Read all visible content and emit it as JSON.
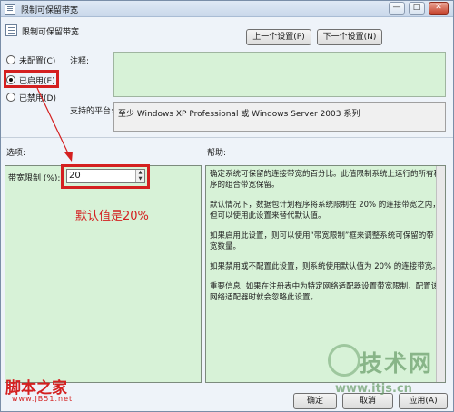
{
  "window": {
    "title": "限制可保留带宽",
    "controls": {
      "minimize": "—",
      "maximize": "□",
      "close": "✕"
    }
  },
  "header": {
    "policy_name": "限制可保留带宽",
    "prev_button": "上一个设置(P)",
    "next_button": "下一个设置(N)"
  },
  "state": {
    "options": [
      {
        "label": "未配置(C)",
        "selected": false
      },
      {
        "label": "已启用(E)",
        "selected": true
      },
      {
        "label": "已禁用(D)",
        "selected": false
      }
    ]
  },
  "comment": {
    "label": "注释:",
    "value": ""
  },
  "platform": {
    "label": "支持的平台:",
    "value": "至少 Windows XP Professional 或 Windows Server 2003 系列"
  },
  "sections": {
    "options_label": "选项:",
    "help_label": "帮助:"
  },
  "options_pane": {
    "field_label": "带宽限制 (%):",
    "field_value": "20",
    "annotation": "默认值是20%"
  },
  "help_text": [
    "确定系统可保留的连接带宽的百分比。此值限制系统上运行的所有程序的组合带宽保留。",
    "默认情况下，数据包计划程序将系统限制在 20% 的连接带宽之内，但可以使用此设置来替代默认值。",
    "如果启用此设置，则可以使用“带宽限制”框来调整系统可保留的带宽数量。",
    "如果禁用或不配置此设置，则系统使用默认值为 20% 的连接带宽。",
    "重要信息: 如果在注册表中为特定网络适配器设置带宽限制，配置该网络适配器时就会忽略此设置。"
  ],
  "footer": {
    "ok_button": "确定",
    "cancel_button": "取消",
    "apply_button": "应用(A)"
  },
  "watermarks": {
    "left_main": "脚本之家",
    "left_sub": "www.JB51.net",
    "right_main": "技术网",
    "right_sub": "www.itjs.cn"
  },
  "colors": {
    "accent_red": "#d42020",
    "pane_green": "#d7f2d7"
  }
}
